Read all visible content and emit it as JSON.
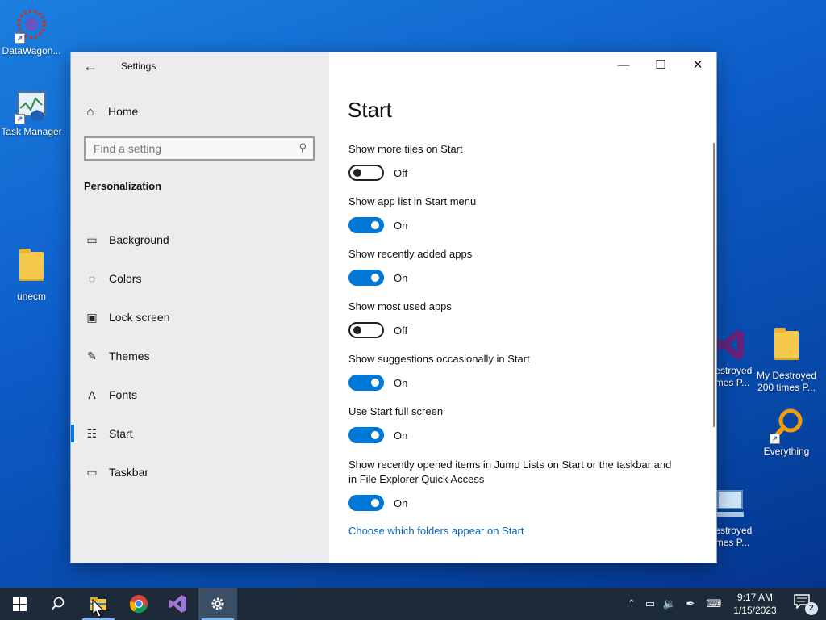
{
  "desktop": {
    "icons": [
      {
        "label": "DataWagon..."
      },
      {
        "label": "Task Manager"
      },
      {
        "label": "unecm"
      },
      {
        "label": "Destroyed times P..."
      },
      {
        "label": "My Destroyed 200 times P..."
      },
      {
        "label": "Everything"
      },
      {
        "label": "Destroyed times P..."
      }
    ]
  },
  "window": {
    "app_title": "Settings",
    "back_icon": "back-arrow-icon",
    "controls": {
      "minimize": "—",
      "maximize": "☐",
      "close": "✕"
    }
  },
  "sidebar": {
    "home_label": "Home",
    "search_placeholder": "Find a setting",
    "section_title": "Personalization",
    "items": [
      {
        "label": "Background",
        "icon": "image-icon",
        "glyph": "▭"
      },
      {
        "label": "Colors",
        "icon": "palette-icon",
        "glyph": "◌"
      },
      {
        "label": "Lock screen",
        "icon": "lock-screen-icon",
        "glyph": "▣"
      },
      {
        "label": "Themes",
        "icon": "brush-icon",
        "glyph": "✎"
      },
      {
        "label": "Fonts",
        "icon": "fonts-icon",
        "glyph": "A"
      },
      {
        "label": "Start",
        "icon": "start-tiles-icon",
        "glyph": "☷"
      },
      {
        "label": "Taskbar",
        "icon": "taskbar-icon",
        "glyph": "▭"
      }
    ],
    "active_item": "Start"
  },
  "content": {
    "title": "Start",
    "settings": [
      {
        "label": "Show more tiles on Start",
        "state": "Off",
        "on": false
      },
      {
        "label": "Show app list in Start menu",
        "state": "On",
        "on": true
      },
      {
        "label": "Show recently added apps",
        "state": "On",
        "on": true
      },
      {
        "label": "Show most used apps",
        "state": "Off",
        "on": false
      },
      {
        "label": "Show suggestions occasionally in Start",
        "state": "On",
        "on": true
      },
      {
        "label": "Use Start full screen",
        "state": "On",
        "on": true
      },
      {
        "label": "Show recently opened items in Jump Lists on Start or the taskbar and in File Explorer Quick Access",
        "state": "On",
        "on": true
      }
    ],
    "link": "Choose which folders appear on Start"
  },
  "taskbar": {
    "clock_time": "9:17 AM",
    "clock_date": "1/15/2023",
    "notification_count": "2"
  },
  "colors": {
    "accent": "#0078d7",
    "taskbar": "#1d2a3a"
  }
}
